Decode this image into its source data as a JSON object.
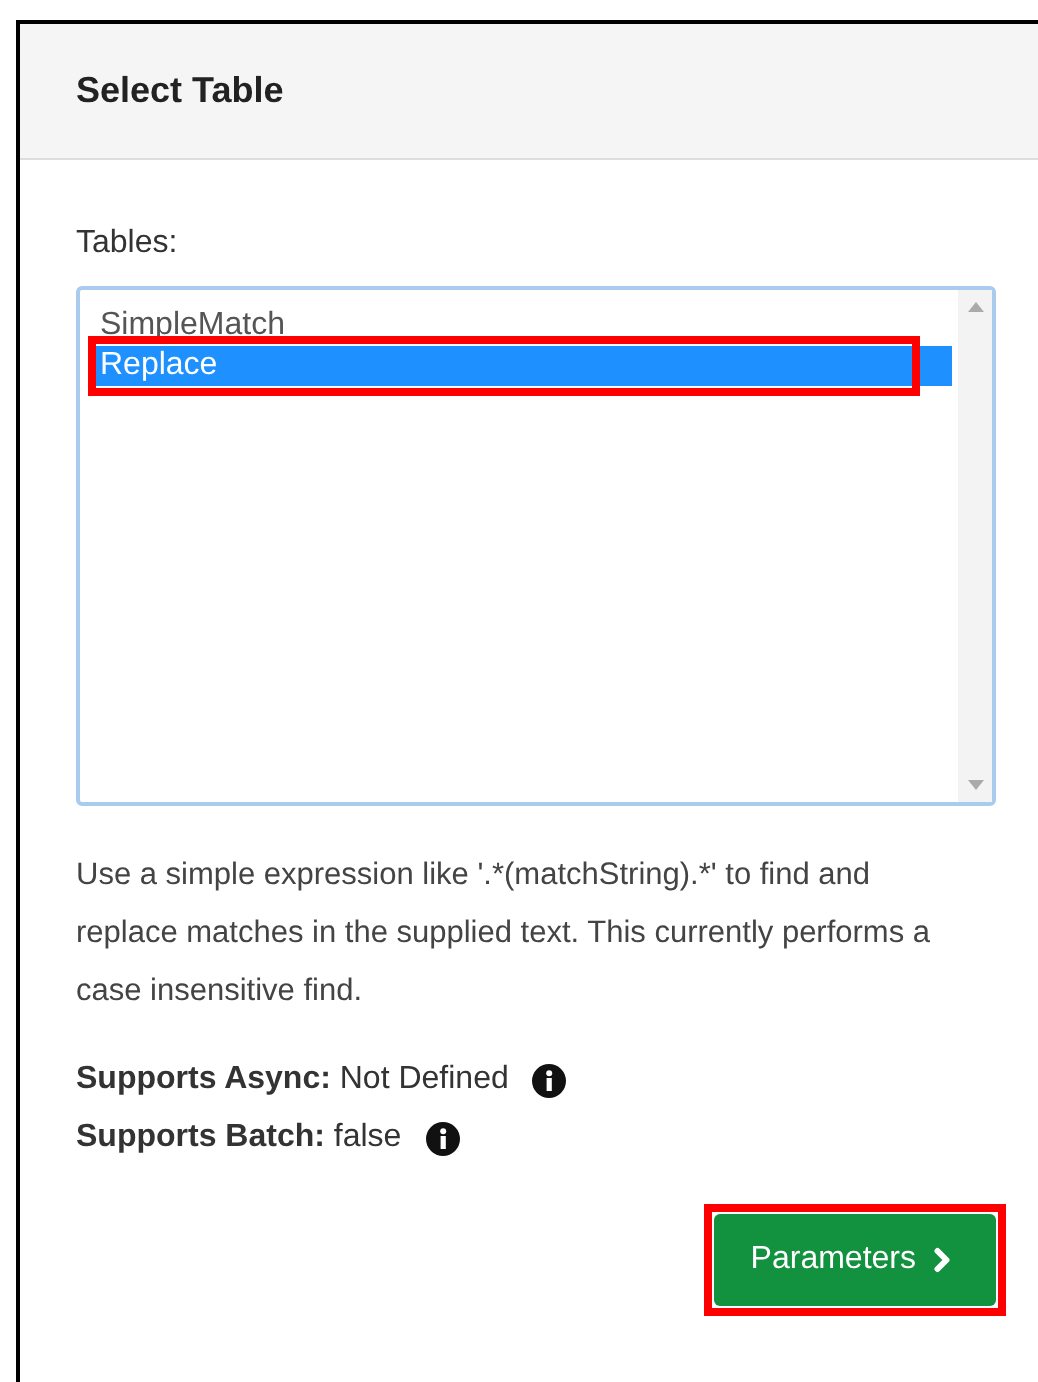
{
  "panel": {
    "title": "Select Table"
  },
  "tables": {
    "label": "Tables:",
    "items": [
      {
        "name": "SimpleMatch",
        "selected": false,
        "highlighted": false
      },
      {
        "name": "Replace",
        "selected": true,
        "highlighted": true
      }
    ]
  },
  "description": "Use a simple expression like '.*(matchString).*' to find and replace matches in the supplied text. This currently performs a case insensitive find.",
  "properties": [
    {
      "label": "Supports Async:",
      "value": "Not Defined"
    },
    {
      "label": "Supports Batch:",
      "value": "false"
    }
  ],
  "next_button": {
    "label": "Parameters",
    "highlighted": true
  }
}
